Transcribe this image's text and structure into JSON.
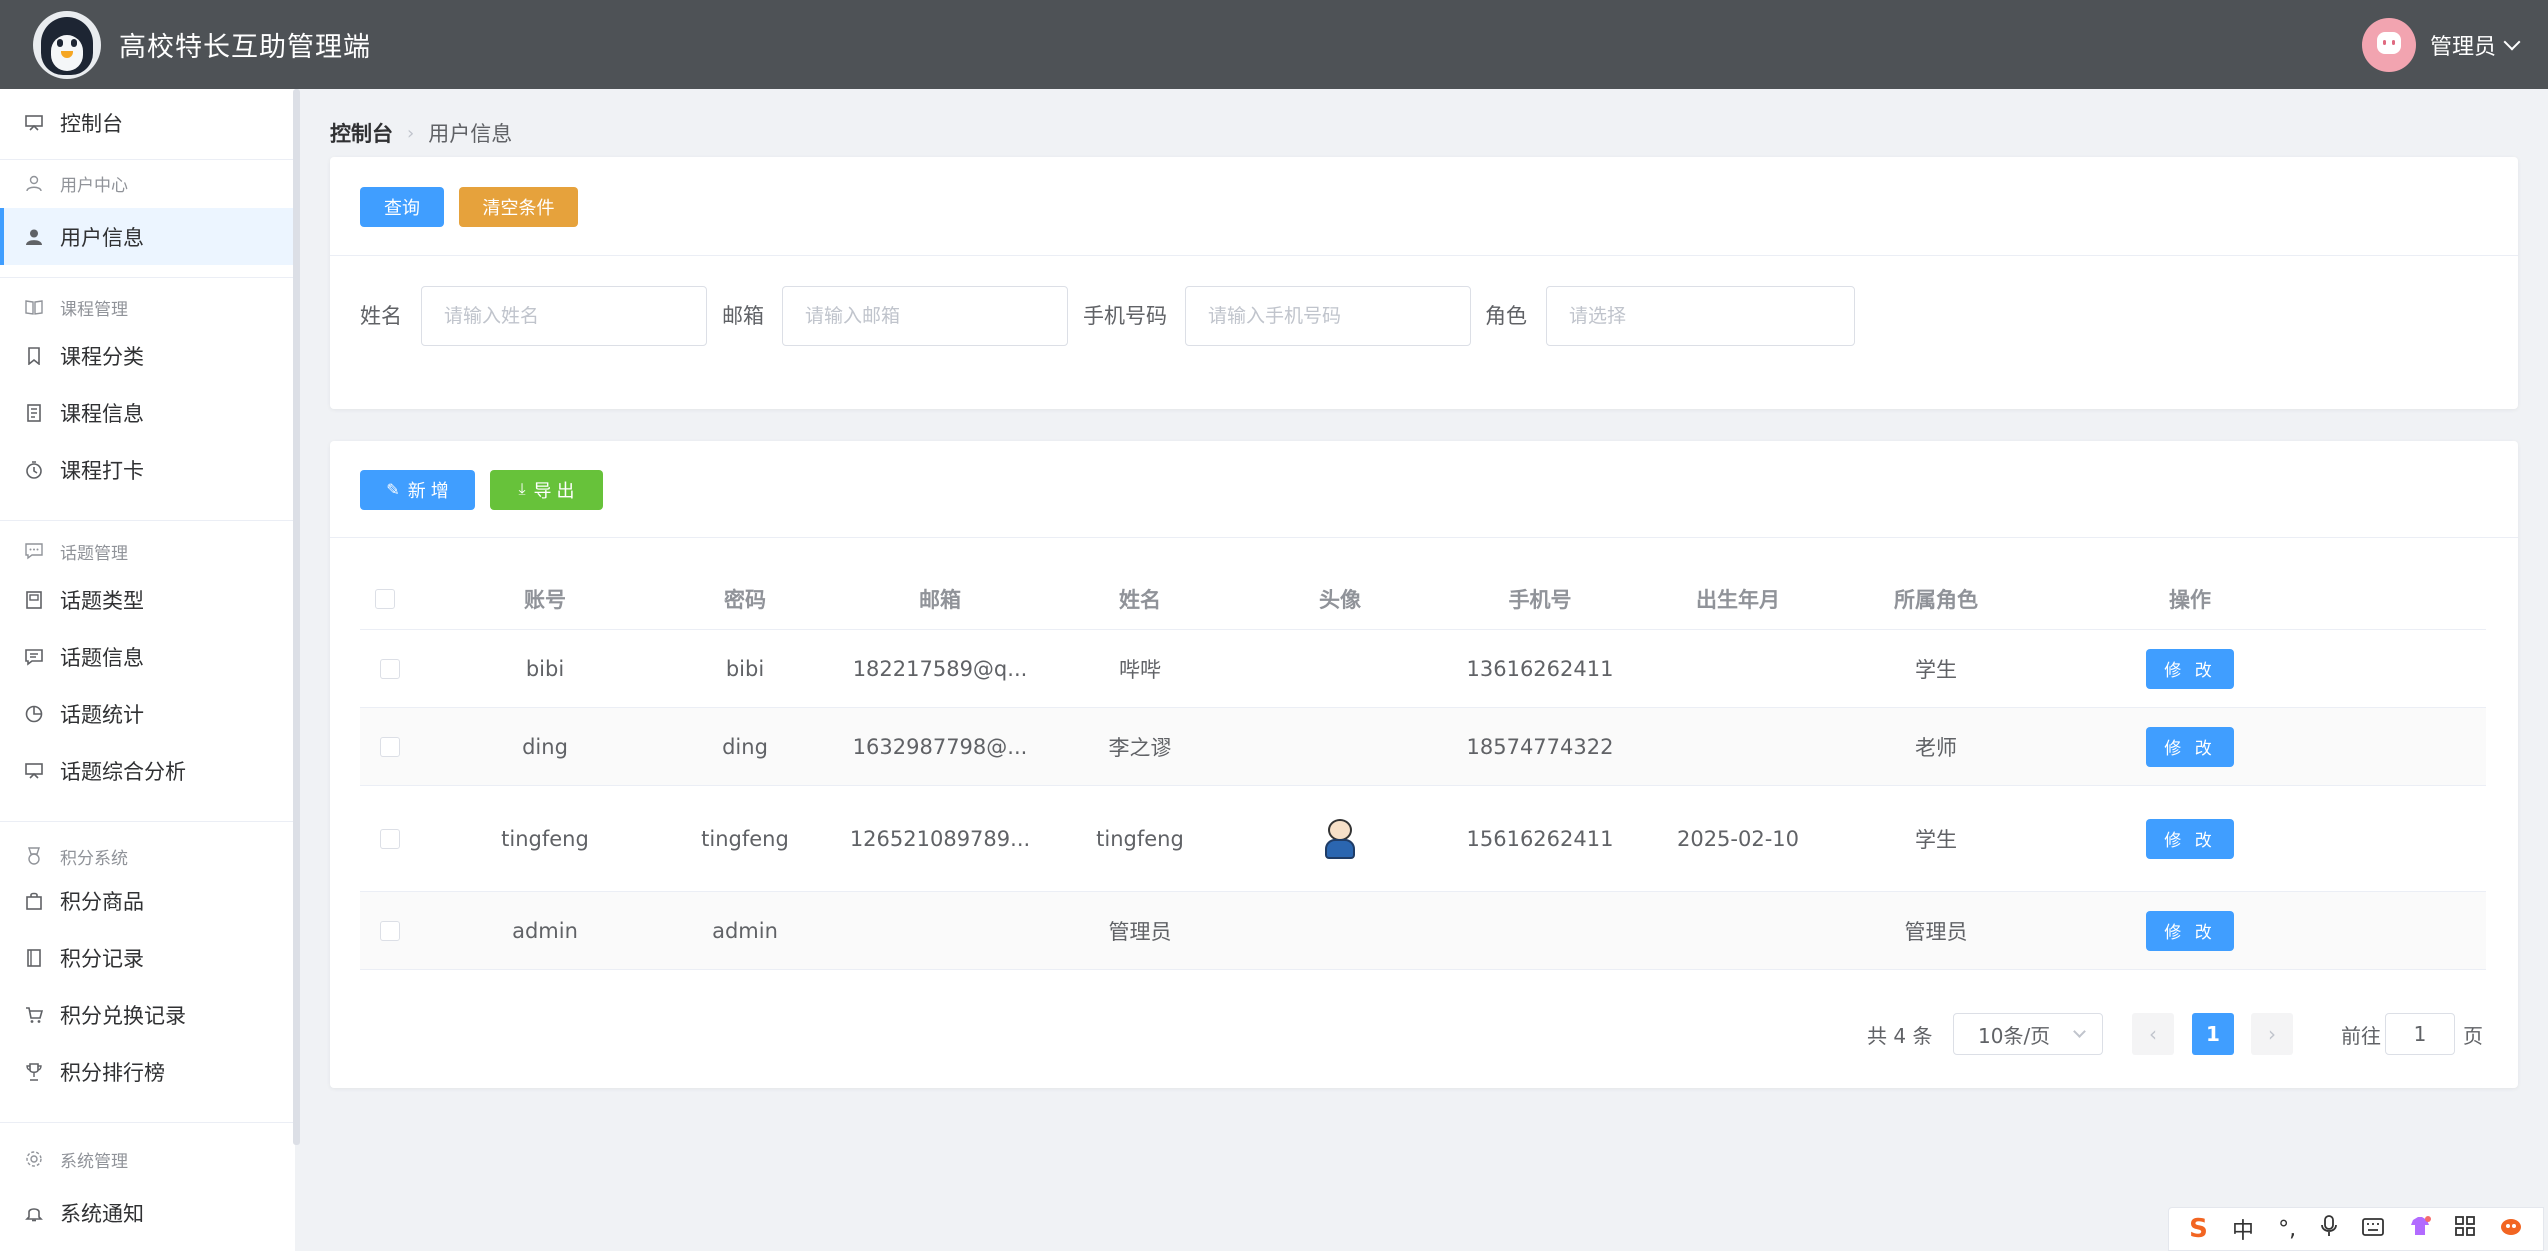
{
  "app": {
    "title": "高校特长互助管理端"
  },
  "user": {
    "name": "管理员"
  },
  "sidebar": {
    "dashboard": "控制台",
    "groups": {
      "user_center": "用户中心",
      "course_mgmt": "课程管理",
      "topic_mgmt": "话题管理",
      "points_system": "积分系统",
      "system_mgmt": "系统管理"
    },
    "items": {
      "user_info": "用户信息",
      "course_category": "课程分类",
      "course_info": "课程信息",
      "course_checkin": "课程打卡",
      "topic_type": "话题类型",
      "topic_info": "话题信息",
      "topic_stats": "话题统计",
      "topic_analysis": "话题综合分析",
      "points_goods": "积分商品",
      "points_records": "积分记录",
      "points_exchange": "积分兑换记录",
      "points_ranking": "积分排行榜",
      "system_notice": "系统通知"
    }
  },
  "breadcrumb": {
    "home": "控制台",
    "current": "用户信息"
  },
  "search": {
    "query_label": "查询",
    "clear_label": "清空条件",
    "fields": {
      "name_label": "姓名",
      "name_placeholder": "请输入姓名",
      "email_label": "邮箱",
      "email_placeholder": "请输入邮箱",
      "phone_label": "手机号码",
      "phone_placeholder": "请输入手机号码",
      "role_label": "角色",
      "role_placeholder": "请选择"
    }
  },
  "toolbar": {
    "add_label": "新 增",
    "export_label": "导 出"
  },
  "table": {
    "headers": [
      "账号",
      "密码",
      "邮箱",
      "姓名",
      "头像",
      "手机号",
      "出生年月",
      "所属角色",
      "操作"
    ],
    "edit_label": "修 改",
    "rows": [
      {
        "account": "bibi",
        "password": "bibi",
        "email": "182217589@q...",
        "name": "哔哔",
        "phone": "13616262411",
        "birth": "",
        "role": "学生"
      },
      {
        "account": "ding",
        "password": "ding",
        "email": "1632987798@...",
        "name": "李之谬",
        "phone": "18574774322",
        "birth": "",
        "role": "老师"
      },
      {
        "account": "tingfeng",
        "password": "tingfeng",
        "email": "126521089789...",
        "name": "tingfeng",
        "phone": "15616262411",
        "birth": "2025-02-10",
        "role": "学生"
      },
      {
        "account": "admin",
        "password": "admin",
        "email": "",
        "name": "管理员",
        "phone": "",
        "birth": "",
        "role": "管理员"
      }
    ]
  },
  "pagination": {
    "total": "共 4 条",
    "page_size": "10条/页",
    "current_page": "1",
    "goto_label": "前往",
    "goto_value": "1",
    "unit": "页"
  },
  "ime": {
    "lang": "中"
  },
  "colors": {
    "primary": "#409eff",
    "warning": "#e6a23c",
    "success": "#67c23a",
    "header": "#4e5256"
  }
}
